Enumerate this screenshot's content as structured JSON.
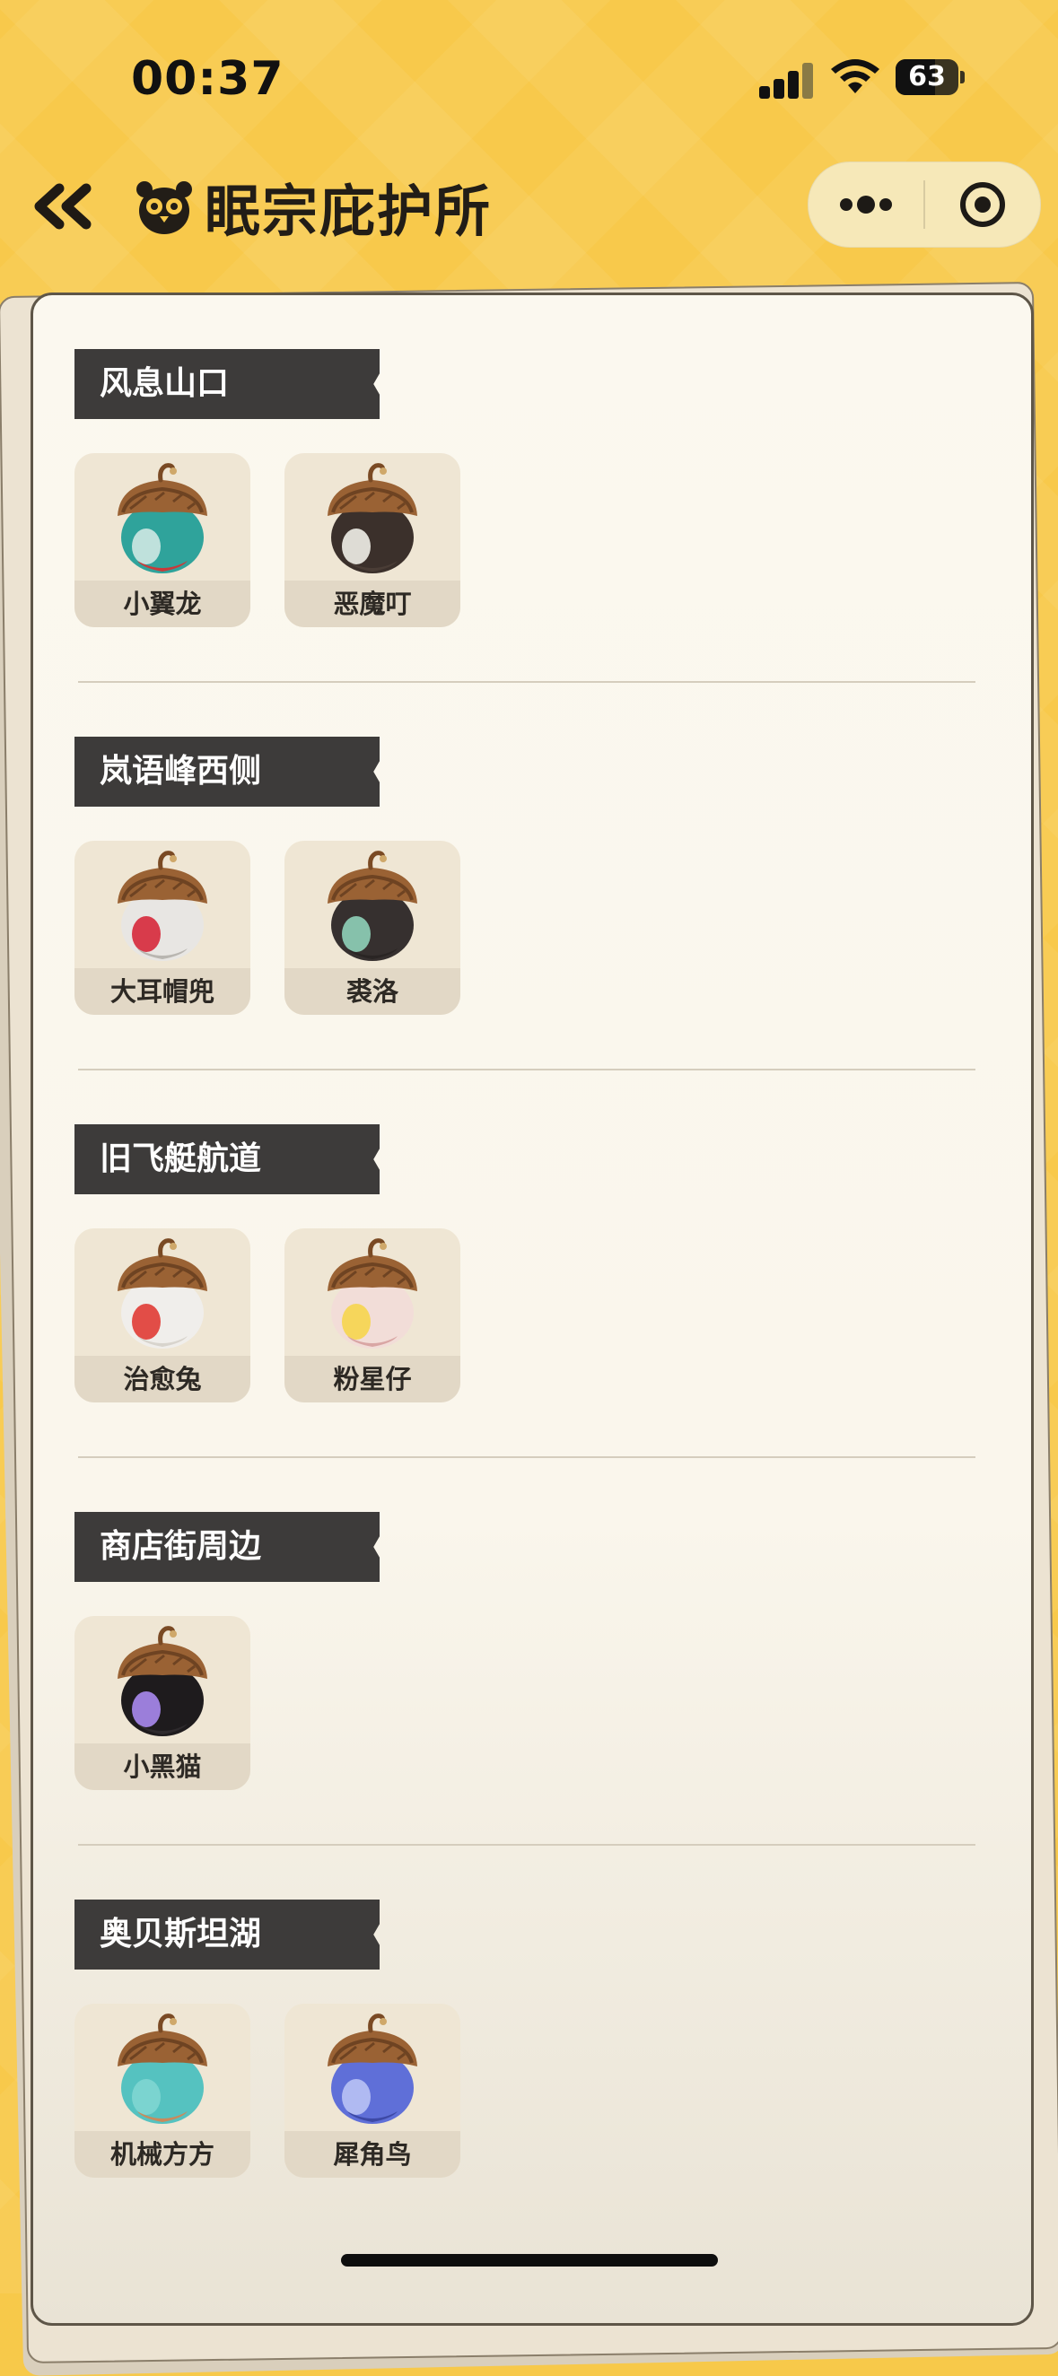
{
  "status_bar": {
    "time": "00:37",
    "battery": "63",
    "battery_level": 0.63
  },
  "nav": {
    "title": "眠宗庇护所"
  },
  "sections": [
    {
      "title": "风息山口",
      "pets": [
        {
          "name": "小翼龙",
          "colors": {
            "body": "#2fa39b",
            "accent": "#c83a3a",
            "mark": "#cfe8e3"
          }
        },
        {
          "name": "恶魔叮",
          "colors": {
            "body": "#3b302b",
            "accent": "#4a3d36",
            "mark": "#f1efe8"
          }
        }
      ]
    },
    {
      "title": "岚语峰西侧",
      "pets": [
        {
          "name": "大耳帽兜",
          "colors": {
            "body": "#e8e6e3",
            "accent": "#b9b6b1",
            "mark": "#d6283a"
          }
        },
        {
          "name": "裘洛",
          "colors": {
            "body": "#36302f",
            "accent": "#2a2524",
            "mark": "#8fd1b9"
          }
        }
      ]
    },
    {
      "title": "旧飞艇航道",
      "pets": [
        {
          "name": "治愈兔",
          "colors": {
            "body": "#f0eeeb",
            "accent": "#d8d4cd",
            "mark": "#e03b35"
          }
        },
        {
          "name": "粉星仔",
          "colors": {
            "body": "#f2ddd8",
            "accent": "#d9a6a4",
            "mark": "#f6d54e"
          }
        }
      ]
    },
    {
      "title": "商店街周边",
      "pets": [
        {
          "name": "小黑猫",
          "colors": {
            "body": "#1e1b1d",
            "accent": "#2e2a2d",
            "mark": "#a98af0"
          }
        }
      ]
    },
    {
      "title": "奥贝斯坦湖",
      "pets": [
        {
          "name": "机械方方",
          "colors": {
            "body": "#55c2c0",
            "accent": "#c98a5c",
            "mark": "#7fd6d2"
          }
        },
        {
          "name": "犀角鸟",
          "colors": {
            "body": "#5f6fd8",
            "accent": "#3d49a6",
            "mark": "#b9c2f5"
          }
        }
      ]
    }
  ]
}
